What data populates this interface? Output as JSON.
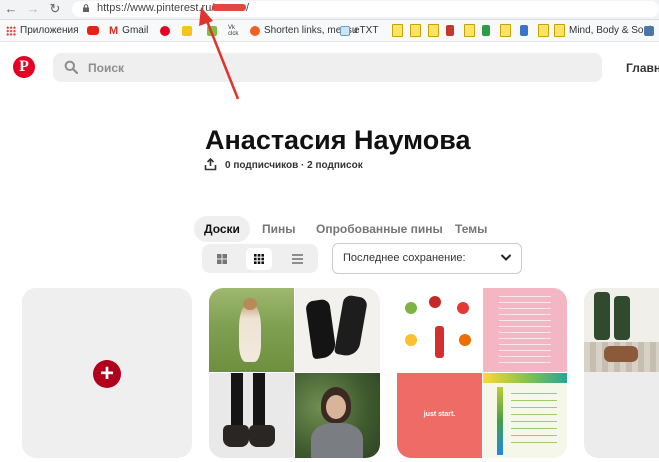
{
  "browser": {
    "url_prefix": "https://www.pinterest.ru/",
    "url_suffix": "/"
  },
  "bookmarks": [
    {
      "label": "Приложения",
      "icon": "apps-grid-icon"
    },
    {
      "label": "",
      "icon": "youtube-icon"
    },
    {
      "label": "Gmail",
      "icon": "gmail-icon"
    },
    {
      "label": "",
      "icon": "pinterest-icon"
    },
    {
      "label": "",
      "icon": "yandex-icon"
    },
    {
      "label": "",
      "icon": "evernote-icon"
    },
    {
      "label": "",
      "icon": "vk-clck-icon"
    },
    {
      "label": "Shorten links, measu",
      "icon": "bitly-icon"
    },
    {
      "label": "eTXT",
      "icon": "etxt-icon"
    },
    {
      "label": "Mind, Body & Soul",
      "icon": "folder-icon"
    }
  ],
  "header": {
    "search_placeholder": "Поиск",
    "nav_label": "Главна"
  },
  "profile": {
    "name": "Анастасия Наумова",
    "followers_text": "0 подписчиков · 2 подписок"
  },
  "tabs": [
    {
      "label": "Доски",
      "active": true
    },
    {
      "label": "Пины",
      "active": false
    },
    {
      "label": "Опробованные пины",
      "active": false
    },
    {
      "label": "Темы",
      "active": false
    }
  ],
  "sort": {
    "selected": "Последнее сохранение:"
  },
  "board_cards": {
    "infographic_caption": "just start."
  },
  "colors": {
    "pinterest_red": "#e60023",
    "annotation_arrow": "#e0332b"
  }
}
